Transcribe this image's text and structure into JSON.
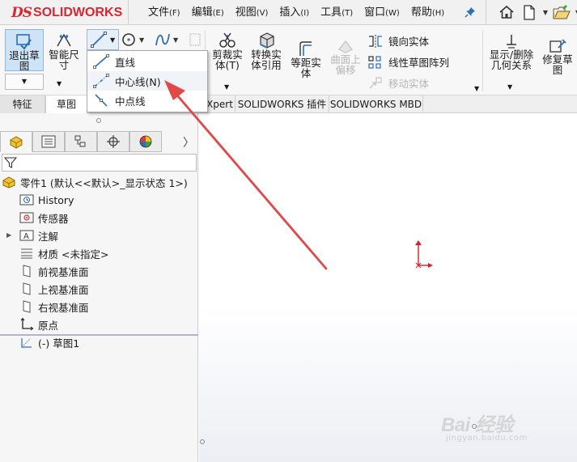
{
  "app": {
    "logo_ds": "DS",
    "logo_name": "SOLIDWORKS"
  },
  "menu": [
    {
      "label": "文件",
      "accel": "(F)"
    },
    {
      "label": "编辑",
      "accel": "(E)"
    },
    {
      "label": "视图",
      "accel": "(V)"
    },
    {
      "label": "插入",
      "accel": "(I)"
    },
    {
      "label": "工具",
      "accel": "(T)"
    },
    {
      "label": "窗口",
      "accel": "(W)"
    },
    {
      "label": "帮助",
      "accel": "(H)"
    }
  ],
  "ribbon": {
    "exit_sketch_l1": "退出草",
    "exit_sketch_l2": "图",
    "smart_dim_l1": "智能尺",
    "smart_dim_l2": "寸",
    "trim_l1": "剪裁实",
    "trim_l2": "体(T)",
    "convert_l1": "转换实",
    "convert_l2": "体引用",
    "offset_l1": "等距实",
    "offset_l2": "体",
    "offset_surface_l1": "曲面上",
    "offset_surface_l2": "偏移",
    "mirror": "镜向实体",
    "linear_pattern": "线性草图阵列",
    "move_entities": "移动实体",
    "display_delete_l1": "显示/删除",
    "display_delete_l2": "几何关系",
    "repair_l1": "修复草",
    "repair_l2": "图"
  },
  "tabs": {
    "features": "特征",
    "sketch": "草图",
    "xpert": "Xpert",
    "addins": "SOLIDWORKS 插件",
    "mbd": "SOLIDWORKS MBD"
  },
  "line_dropdown": {
    "line": "直线",
    "centerline": "中心线(N)",
    "midline": "中点线"
  },
  "tree": {
    "part": "零件1  (默认<<默认>_显示状态 1>)",
    "history": "History",
    "sensors": "传感器",
    "annotations": "注解",
    "material": "材质 <未指定>",
    "front_plane": "前视基准面",
    "top_plane": "上视基准面",
    "right_plane": "右视基准面",
    "origin": "原点",
    "sketch1": "(-) 草图1"
  },
  "watermark": {
    "brand": "Bai 经验",
    "url": "jingyan.baidu.com"
  },
  "colors": {
    "brand_red": "#d8272f",
    "annotation_red": "#e34848",
    "selected_blue": "#cfe3f6"
  }
}
